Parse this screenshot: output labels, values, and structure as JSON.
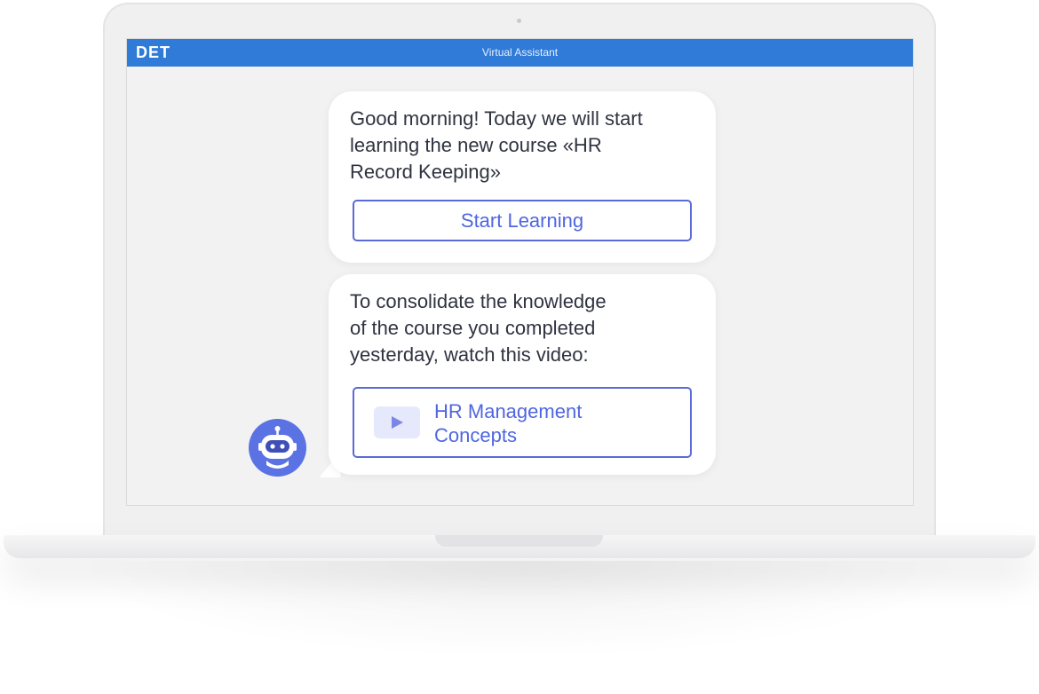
{
  "header": {
    "brand": "DET",
    "title": "Virtual Assistant"
  },
  "messages": [
    {
      "lines": [
        "Good morning! Today we will start",
        "learning the new course «HR",
        "Record Keeping»"
      ],
      "button_label": "Start Learning"
    },
    {
      "lines": [
        "To consolidate the knowledge",
        "of the course you completed",
        "yesterday, watch this video:"
      ],
      "video": {
        "title_lines": [
          "HR Management",
          "Concepts"
        ],
        "icon": "play-icon"
      }
    }
  ],
  "assistant": {
    "icon": "robot-icon"
  },
  "colors": {
    "accent": "#2f7bd7",
    "link": "#4f66e0",
    "avatar": "#5b72e4"
  }
}
